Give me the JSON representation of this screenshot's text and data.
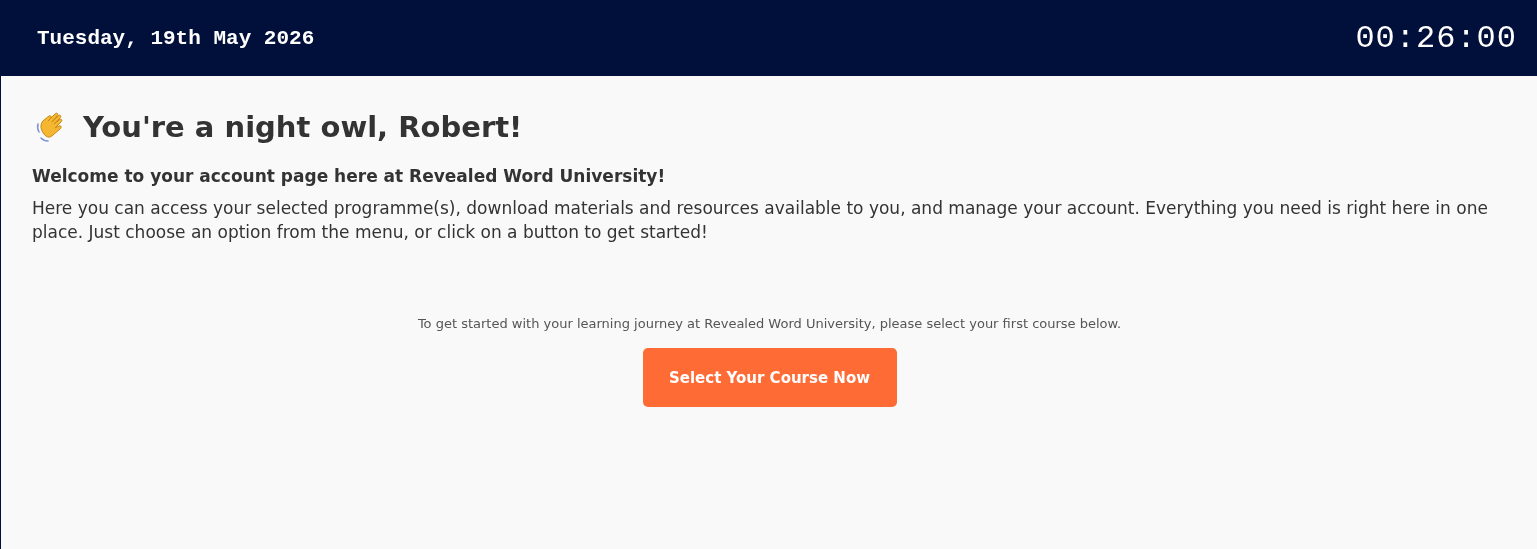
{
  "header": {
    "date": "Tuesday, 19th May 2026",
    "clock": "00:26:00"
  },
  "greeting": {
    "title": "You're a night owl, Robert!"
  },
  "welcome": "Welcome to your account page here at Revealed Word University!",
  "intro": "Here you can access your selected programme(s), download materials and resources available to you, and manage your account. Everything you need is right here in one place. Just choose an option from the menu, or click on a button to get started!",
  "prompt": "To get started with your learning journey at Revealed Word University, please select your first course below.",
  "button": "Select Your Course Now"
}
